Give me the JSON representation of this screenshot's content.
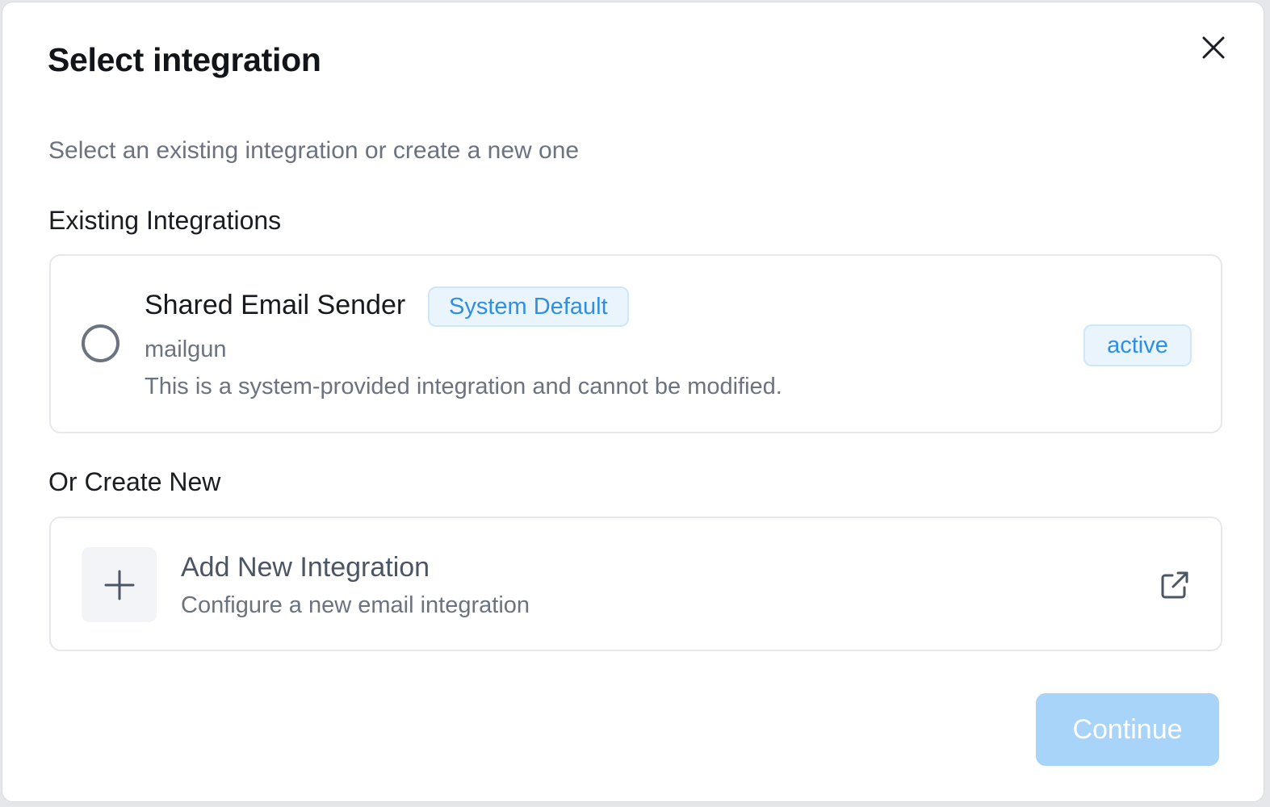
{
  "dialog": {
    "title": "Select integration",
    "subtitle": "Select an existing integration or create a new one",
    "close_icon": "close-icon"
  },
  "existing": {
    "heading": "Existing Integrations",
    "items": [
      {
        "name": "Shared Email Sender",
        "badge": "System Default",
        "provider": "mailgun",
        "description": "This is a system-provided integration and cannot be modified.",
        "status": "active",
        "selected": false
      }
    ]
  },
  "create": {
    "heading": "Or Create New",
    "title": "Add New Integration",
    "description": "Configure a new email integration",
    "icon": "plus-icon",
    "link_icon": "external-link-icon"
  },
  "footer": {
    "continue_label": "Continue",
    "continue_enabled": false
  },
  "colors": {
    "accent": "#2f8fe0",
    "badge_bg": "#eaf4fd",
    "button_disabled": "#a9d4fa"
  }
}
